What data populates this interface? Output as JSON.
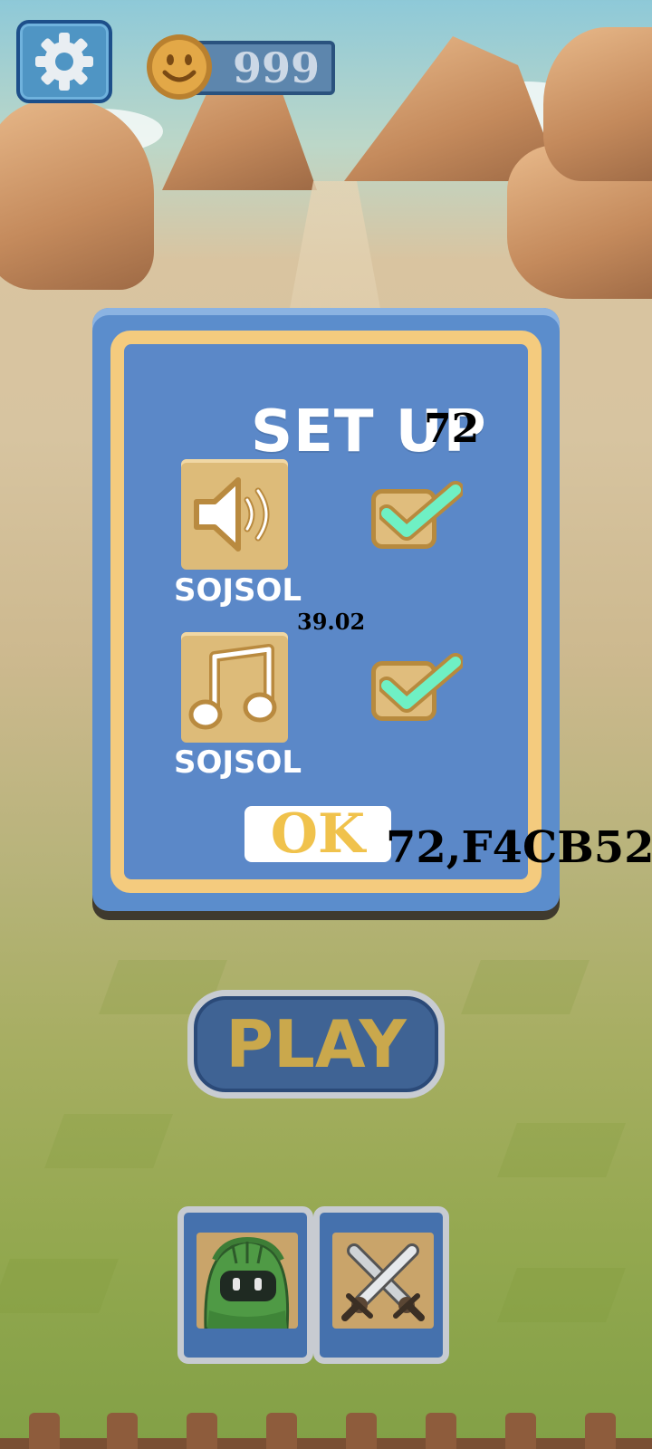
{
  "hud": {
    "coin_count": "999"
  },
  "settings_modal": {
    "title": "SET UP",
    "annotation_title_number": "72",
    "options": [
      {
        "icon": "speaker-icon",
        "label": "SOJSOL",
        "checked": true
      },
      {
        "icon": "music-note-icon",
        "label": "SOJSOL",
        "checked": true
      }
    ],
    "annotation_between_options": "39.02",
    "ok_label": "OK",
    "annotation_ok": "72,F4CB52"
  },
  "play_label": "PLAY",
  "character_slots": [
    {
      "icon": "green-knight-icon"
    },
    {
      "icon": "crossed-swords-icon"
    }
  ],
  "colors": {
    "modal_blue": "#5B88C8",
    "modal_gold": "#F4CB7E",
    "check_green": "#6FF0C4",
    "ok_gold": "#F0C24C",
    "play_gold": "#CAA84C"
  }
}
